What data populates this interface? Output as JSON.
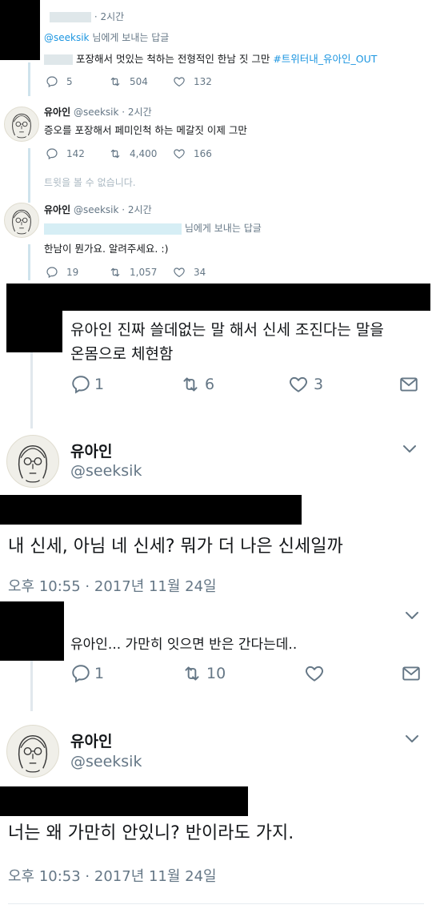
{
  "tweets_small": [
    {
      "time": "· 2시간",
      "reply_to_handle": "@seeksik",
      "reply_to_suffix": "님에게 보내는 답글",
      "text": "포장해서 멋있는 척하는 전형적인 한남 짓 그만",
      "hashtag": "#트위터내_유아인_OUT",
      "replies": "5",
      "retweets": "504",
      "likes": "132"
    },
    {
      "name": "유아인",
      "handle": "@seeksik",
      "time": "· 2시간",
      "text": "증오를 포장해서 페미인척 하는 메갈짓 이제 그만",
      "replies": "142",
      "retweets": "4,400",
      "likes": "166"
    },
    {
      "unavailable": "트윗을 볼 수 없습니다."
    },
    {
      "name": "유아인",
      "handle": "@seeksik",
      "time": "· 2시간",
      "reply_suffix": "님에게 보내는 답글",
      "text": "한남이 뭔가요. 알려주세요. :)",
      "replies": "19",
      "retweets": "1,057",
      "likes": "34"
    }
  ],
  "reply1": {
    "text_line1": "유아인 진짜 쓸데없는 말 해서 신세 조진다는 말을",
    "text_line2": "온몸으로 체현함",
    "replies": "1",
    "retweets": "6",
    "likes": "3"
  },
  "main1": {
    "name": "유아인",
    "handle": "@seeksik",
    "text": "내 신세, 아님 네 신세? 뭐가 더 나은 신세일까",
    "timestamp": "오후 10:55 · 2017년 11월 24일"
  },
  "reply2": {
    "text": "유아인... 가만히 잇으면 반은 간다는데..",
    "replies": "1",
    "retweets": "10",
    "likes": ""
  },
  "main2": {
    "name": "유아인",
    "handle": "@seeksik",
    "text": "너는 왜 가만히 안있니? 반이라도 가지.",
    "timestamp": "오후 10:53 · 2017년 11월 24일"
  },
  "icons": {
    "reply": "reply-icon",
    "retweet": "retweet-icon",
    "like": "heart-icon",
    "dm": "mail-icon",
    "more": "chevron-down-icon"
  },
  "colors": {
    "link": "#1b95e0",
    "muted": "#657786",
    "thread_line": "#cfe3ec"
  }
}
